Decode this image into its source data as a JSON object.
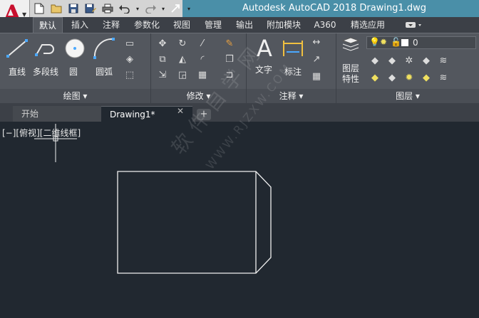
{
  "app": {
    "title": "Autodesk AutoCAD 2018    Drawing1.dwg",
    "logo_letter": "A"
  },
  "quick_access": {
    "icons": [
      "new-icon",
      "open-icon",
      "save-icon",
      "saveas-icon",
      "print-icon",
      "undo-icon",
      "redo-icon",
      "share-icon"
    ]
  },
  "tabs": [
    "默认",
    "插入",
    "注释",
    "参数化",
    "视图",
    "管理",
    "输出",
    "附加模块",
    "A360",
    "精选应用"
  ],
  "active_tab": "默认",
  "ribbon": {
    "draw": {
      "title": "绘图",
      "line": "直线",
      "polyline": "多段线",
      "circle": "圆",
      "arc": "圆弧"
    },
    "modify": {
      "title": "修改"
    },
    "annotation": {
      "title": "注释",
      "text": "文字",
      "dimension": "标注"
    },
    "layers": {
      "title": "图层",
      "properties": "图层\n特性",
      "current_layer": "0"
    }
  },
  "file_tabs": {
    "start": "开始",
    "drawing": "Drawing1*",
    "close": "✕",
    "new": "+"
  },
  "viewport": {
    "label": "[−][俯视][二维线框]"
  },
  "watermark": {
    "text": "软件自学网",
    "url": "WWW.RJZXW.COM"
  },
  "colors": {
    "canvas": "#212830",
    "ribbon": "#53575e",
    "titlebar_accent": "#4a8fa8",
    "logo": "#c8102e"
  }
}
